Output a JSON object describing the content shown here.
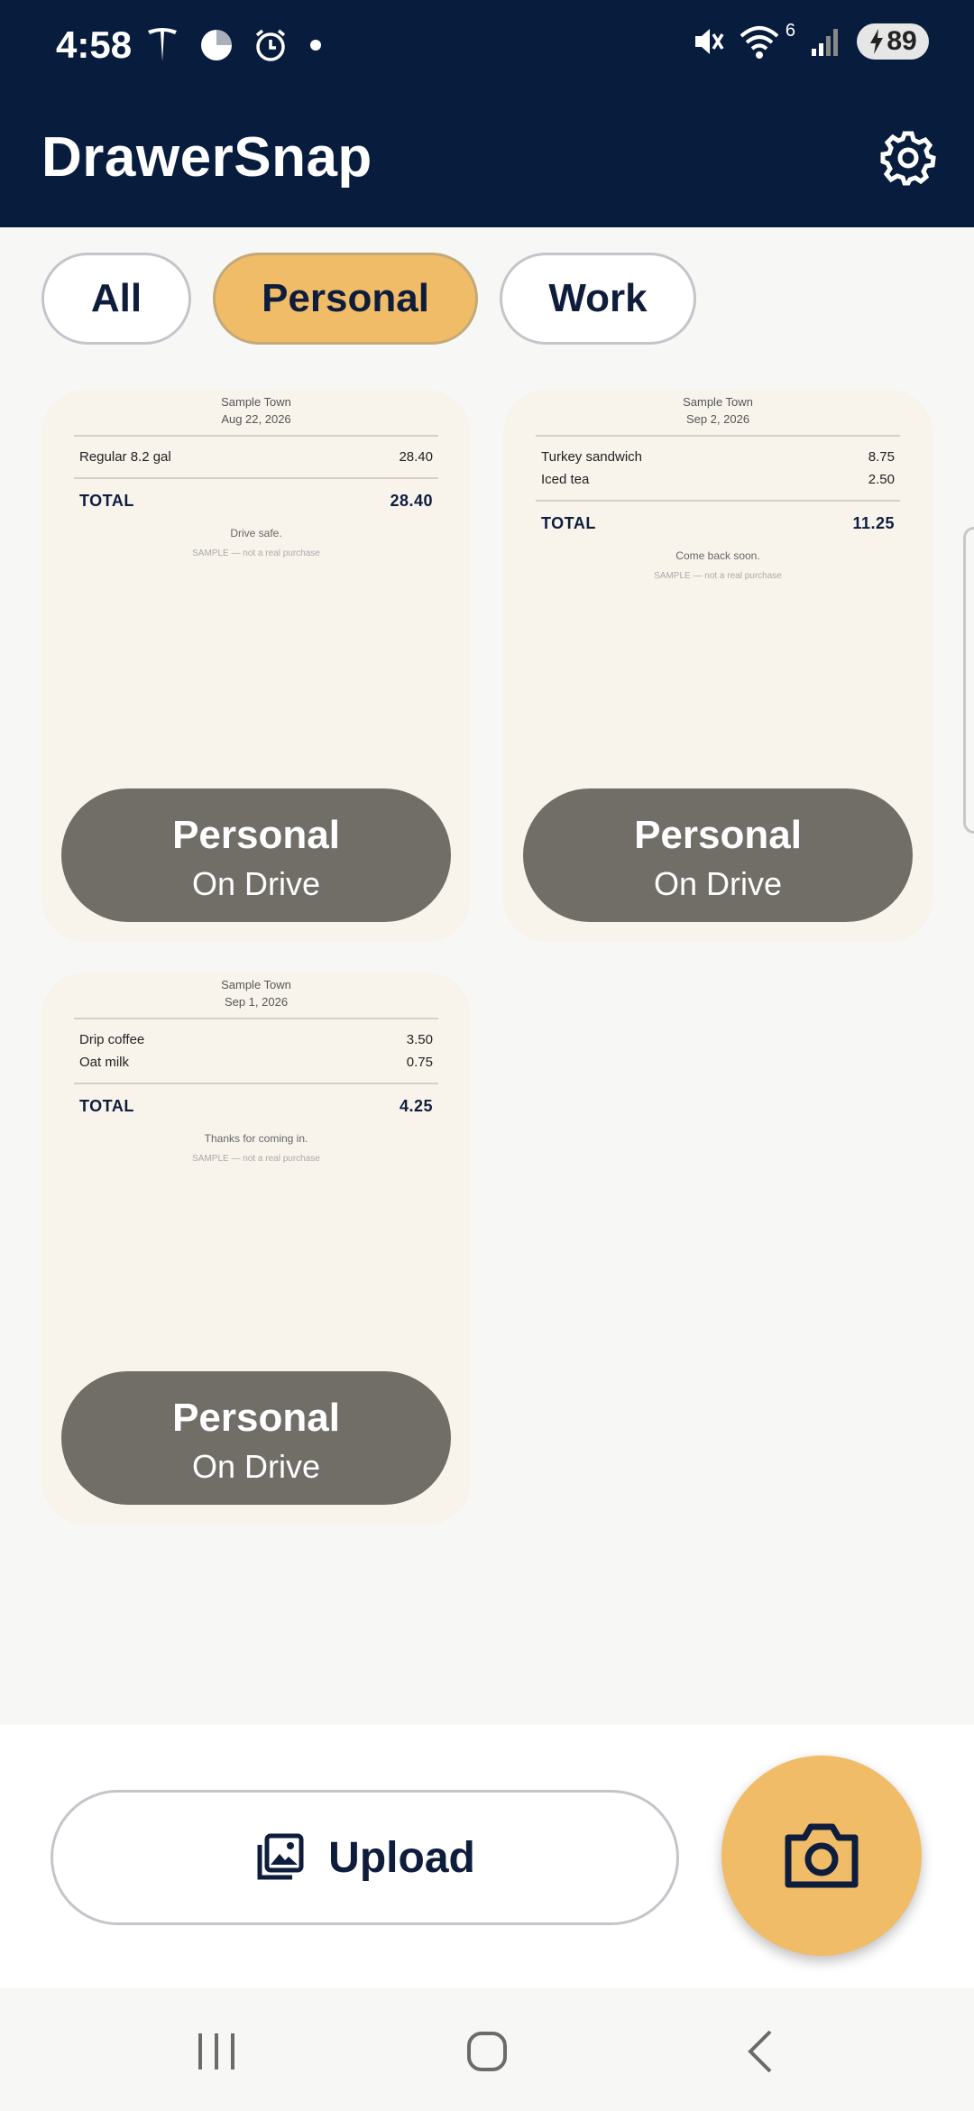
{
  "status_bar": {
    "time": "4:58",
    "battery": "89",
    "wifi_label": "6"
  },
  "header": {
    "title": "DrawerSnap"
  },
  "filters": [
    {
      "label": "All",
      "active": false
    },
    {
      "label": "Personal",
      "active": true
    },
    {
      "label": "Work",
      "active": false
    }
  ],
  "receipts": [
    {
      "town": "Sample Town",
      "date": "Aug 22, 2026",
      "items": [
        {
          "name": "Regular 8.2 gal",
          "price": "28.40"
        }
      ],
      "total_label": "TOTAL",
      "total": "28.40",
      "message": "Drive safe.",
      "sample_note": "SAMPLE — not a real purchase",
      "category": "Personal",
      "location": "On Drive"
    },
    {
      "town": "Sample Town",
      "date": "Sep 2, 2026",
      "items": [
        {
          "name": "Turkey sandwich",
          "price": "8.75"
        },
        {
          "name": "Iced tea",
          "price": "2.50"
        }
      ],
      "total_label": "TOTAL",
      "total": "11.25",
      "message": "Come back soon.",
      "sample_note": "SAMPLE — not a real purchase",
      "category": "Personal",
      "location": "On Drive"
    },
    {
      "town": "Sample Town",
      "date": "Sep 1, 2026",
      "items": [
        {
          "name": "Drip coffee",
          "price": "3.50"
        },
        {
          "name": "Oat milk",
          "price": "0.75"
        }
      ],
      "total_label": "TOTAL",
      "total": "4.25",
      "message": "Thanks for coming in.",
      "sample_note": "SAMPLE — not a real purchase",
      "category": "Personal",
      "location": "On Drive"
    }
  ],
  "actions": {
    "upload_label": "Upload"
  },
  "colors": {
    "header_bg": "#081c3e",
    "accent": "#f0bc68",
    "badge_bg": "#716e68"
  }
}
